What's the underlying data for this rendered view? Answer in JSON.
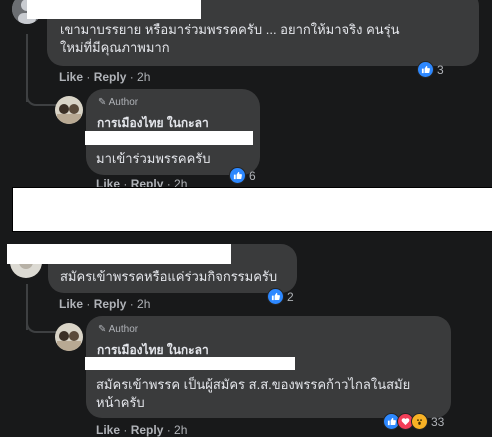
{
  "comment1": {
    "text_line1": "เขามาบรรยาย หรือมาร่วมพรรคครับ ... อยากให้มาจริง คนรุ่น",
    "text_line2": "ใหม่ที่มีคุณภาพมาก",
    "like": "Like",
    "reply": "Reply",
    "time": "2h",
    "reactions": "3"
  },
  "reply1": {
    "author_badge": "Author",
    "author_name": "การเมืองไทย ในกะลา",
    "text": "มาเข้าร่วมพรรคครับ",
    "like": "Like",
    "reply": "Reply",
    "time": "2h",
    "reactions": "6"
  },
  "comment2": {
    "text": "สมัครเข้าพรรคหรือแค่ร่วมกิจกรรมครับ",
    "like": "Like",
    "reply": "Reply",
    "time": "2h",
    "reactions": "2"
  },
  "reply2": {
    "author_badge": "Author",
    "author_name": "การเมืองไทย ในกะลา",
    "text_line1": "สมัครเข้าพรรค เป็นผู้สมัคร ส.ส.ของพรรคก้าวไกลในสมัย",
    "text_line2": "หน้าครับ",
    "like": "Like",
    "reply": "Reply",
    "time": "2h",
    "reactions": "33"
  },
  "colors": {
    "background": "#18191a",
    "bubble": "#3a3b3c",
    "like_blue": "#2d88ff",
    "love_red": "#f33e58",
    "wow_yellow": "#f7b125"
  }
}
